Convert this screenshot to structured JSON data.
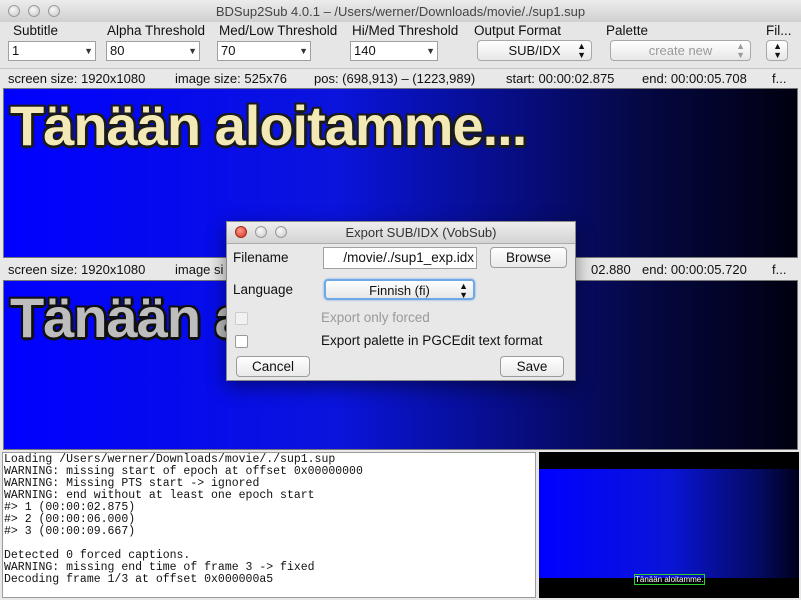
{
  "window": {
    "title": "BDSup2Sub 4.0.1 – /Users/werner/Downloads/movie/./sup1.sup"
  },
  "toolbar": {
    "subtitle": {
      "label": "Subtitle",
      "value": "1"
    },
    "alpha": {
      "label": "Alpha Threshold",
      "value": "80"
    },
    "medlow": {
      "label": "Med/Low Threshold",
      "value": "70"
    },
    "himed": {
      "label": "Hi/Med Threshold",
      "value": "140"
    },
    "output": {
      "label": "Output Format",
      "value": "SUB/IDX"
    },
    "palette": {
      "label": "Palette",
      "value": "create new"
    },
    "filter": {
      "label": "Fil..."
    }
  },
  "info_top": {
    "screen": "screen size: 1920x1080",
    "image": "image size: 525x76",
    "pos": "pos: (698,913) – (1223,989)",
    "start": "start: 00:00:02.875",
    "end": "end: 00:00:05.708",
    "more": "f..."
  },
  "info_bottom": {
    "screen": "screen size: 1920x1080",
    "image": "image si",
    "start": "02.880",
    "end": "end: 00:00:05.720",
    "more": "f..."
  },
  "preview_top": {
    "text": "Tänään aloitamme..."
  },
  "preview_bottom": {
    "text": "Tänään a"
  },
  "log": {
    "lines": [
      "Loading /Users/werner/Downloads/movie/./sup1.sup",
      "WARNING: missing start of epoch at offset 0x00000000",
      "WARNING: Missing PTS start -> ignored",
      "WARNING: end without at least one epoch start",
      "#> 1 (00:00:02.875)",
      "#> 2 (00:00:06.000)",
      "#> 3 (00:00:09.667)",
      "",
      "Detected 0 forced captions.",
      "WARNING: missing end time of frame 3 -> fixed",
      "Decoding frame 1/3 at offset 0x000000a5"
    ]
  },
  "thumbnail": {
    "caption": "Tänään aloitamme..."
  },
  "dialog": {
    "title": "Export SUB/IDX (VobSub)",
    "filename_label": "Filename",
    "filename_value": "/movie/./sup1_exp.idx",
    "browse_label": "Browse",
    "language_label": "Language",
    "language_value": "Finnish (fi)",
    "forced_label": "Export only forced",
    "palette_label": "Export palette in PGCEdit text format",
    "cancel_label": "Cancel",
    "save_label": "Save"
  },
  "colors": {
    "preview_text_top": "#f3e9b6",
    "preview_text_bottom": "#bdbdbd",
    "thumbnail_outline": "#2bd02b"
  }
}
